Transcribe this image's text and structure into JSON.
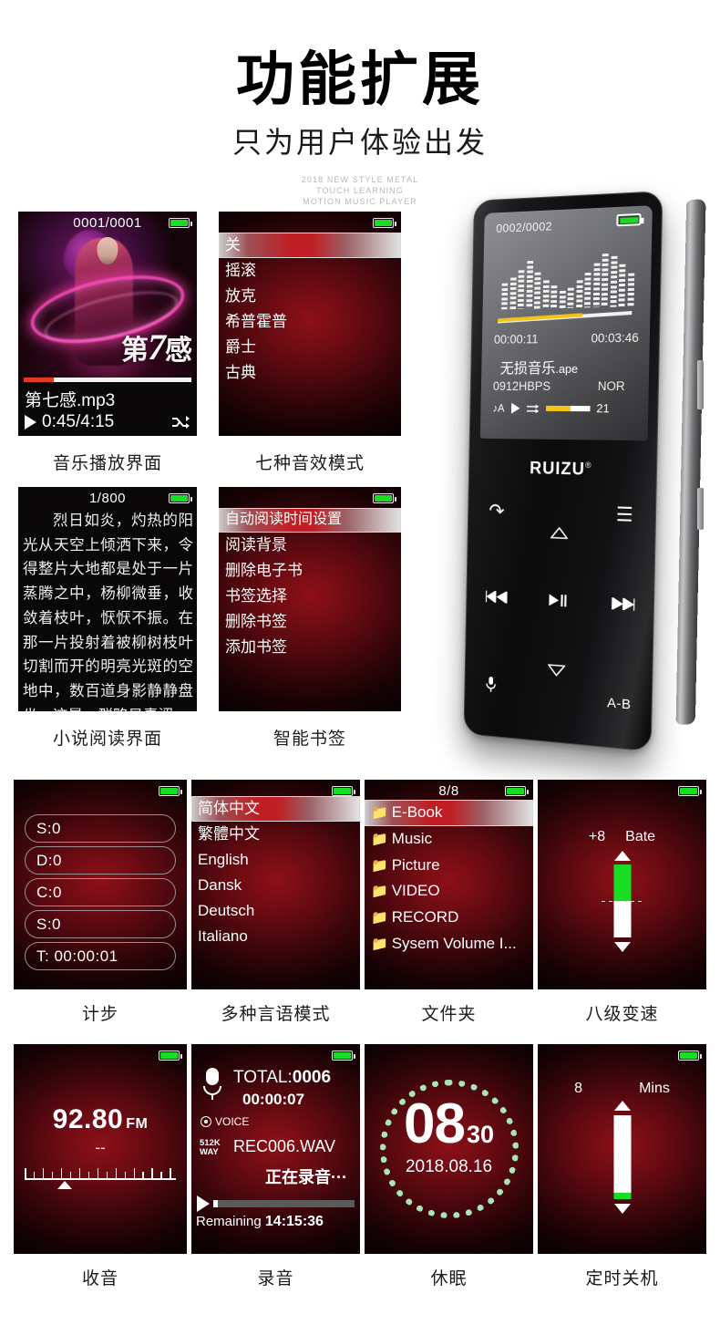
{
  "header": {
    "title": "功能扩展",
    "subtitle": "只为用户体验出发",
    "en_line1": "2018 NEW STYLE METAL",
    "en_line2": "TOUCH LEARNING",
    "en_line3": "MOTION MUSIC PLAYER"
  },
  "panels": {
    "music": {
      "caption": "音乐播放界面",
      "track_counter": "0001/0001",
      "album_logo_prefix": "第",
      "album_logo_seven": "7",
      "album_logo_suffix": "感",
      "song_file": "第七感.mp3",
      "time": "0:45/4:15",
      "progress_percent": 18,
      "shuffle_icon": "shuffle-icon"
    },
    "eq": {
      "caption": "七种音效模式",
      "items": [
        "关",
        "摇滚",
        "放克",
        "希普霍普",
        "爵士",
        "古典"
      ],
      "selected_index": 0
    },
    "ebook": {
      "caption": "小说阅读界面",
      "page": "1/800",
      "body": "烈日如炎，灼热的阳光从天空上倾洒下来，令得整片大地都是处于一片蒸腾之中，杨柳微垂，收敛着枝叶，恹恹不振。在那一片投射着被柳树枝叶切割而开的明亮光斑的空地中，数百道身影静静盘坐，这是一群略显青涩"
    },
    "bookmark": {
      "caption": "智能书签",
      "items": [
        "自动阅读时间设置",
        "阅读背景",
        "删除电子书",
        "书签选择",
        "删除书签",
        "添加书签"
      ],
      "selected_index": 0
    },
    "pedometer": {
      "caption": "计步",
      "rows": [
        "S:0",
        "D:0",
        "C:0",
        "S:0",
        "T:   00:00:01"
      ]
    },
    "language": {
      "caption": "多种言语模式",
      "items": [
        "简体中文",
        "繁體中文",
        "English",
        "Dansk",
        "Deutsch",
        "Italiano"
      ],
      "selected_index": 0
    },
    "folder": {
      "caption": "文件夹",
      "counter": "8/8",
      "items": [
        "E-Book",
        "Music",
        "Picture",
        "VIDEO",
        "RECORD",
        "Sysem Volume I..."
      ],
      "selected_index": 0
    },
    "speed": {
      "caption": "八级变速",
      "value": "+8",
      "unit": "Bate",
      "fill_percent": 50
    },
    "radio": {
      "caption": "收音",
      "frequency": "92.80",
      "band": "FM",
      "station": "--"
    },
    "recorder": {
      "caption": "录音",
      "total_label": "TOTAL:",
      "total_value": "0006",
      "elapsed": "00:00:07",
      "source": "VOICE",
      "bitrate_line1": "512K",
      "bitrate_line2": "WAY",
      "filename": "REC006.WAV",
      "status": "正在录音···",
      "remaining_label": "Remaining",
      "remaining_value": "14:15:36"
    },
    "clock": {
      "caption": "休眠",
      "hour": "08",
      "minute": "30",
      "date": "2018.08.16"
    },
    "sleep_timer": {
      "caption": "定时关机",
      "value": "8",
      "unit": "Mins",
      "fill_percent": 8
    }
  },
  "device": {
    "brand": "RUIZU",
    "brand_sup": "®",
    "track_counter": "0002/0002",
    "elapsed": "00:00:11",
    "duration": "00:03:46",
    "song_title": "无损音乐",
    "song_ext": ".ape",
    "bitrate": "0912HBPS",
    "eq_mode": "NOR",
    "repeat_icon": "repeat-a-icon",
    "repeat_label": "A",
    "play_icon": "play-icon",
    "shuffle_icon": "shuffle-icon",
    "volume": "21",
    "controls": {
      "back": "back-icon",
      "menu": "menu-icon",
      "up": "up-arrow-icon",
      "prev": "previous-track-icon",
      "playpause": "play-pause-icon",
      "next": "next-track-icon",
      "down": "down-arrow-icon",
      "mic": "microphone-icon",
      "ab": "A-B"
    }
  }
}
